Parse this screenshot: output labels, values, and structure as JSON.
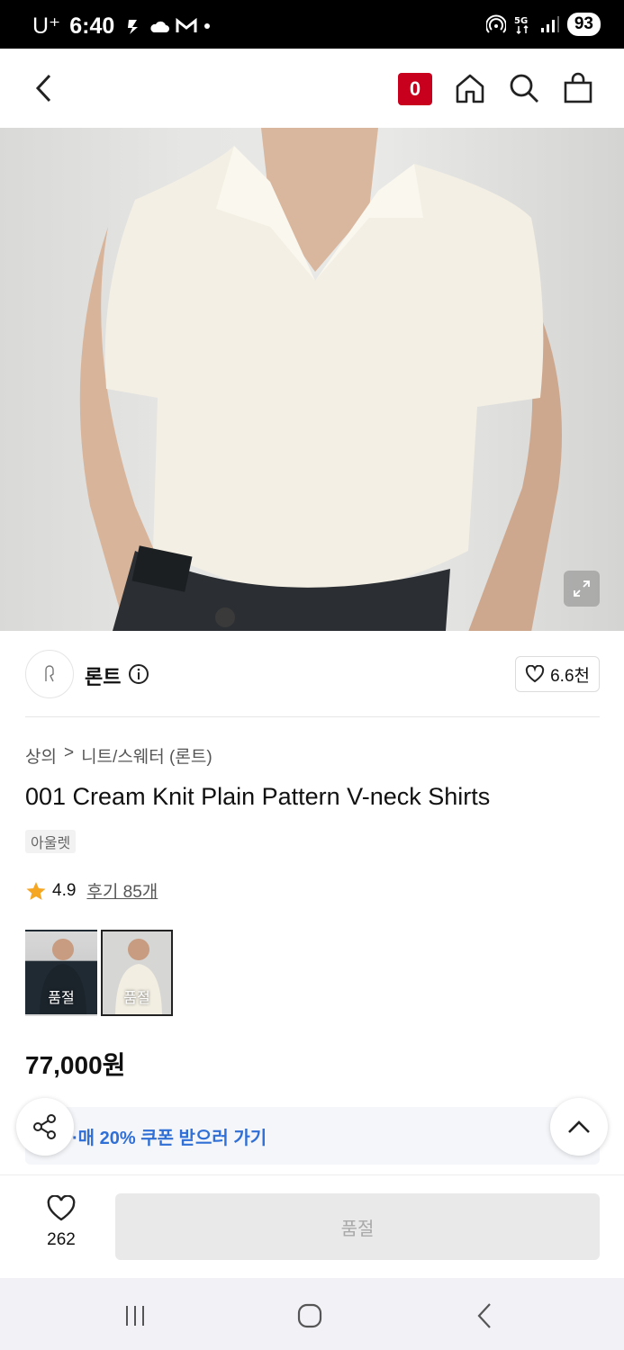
{
  "status_bar": {
    "carrier": "U⁺",
    "time": "6:40",
    "battery": "93",
    "icons": [
      "runner-icon",
      "cloud-icon",
      "gmail-icon",
      "hotspot-icon",
      "5g-icon",
      "signal-icon"
    ]
  },
  "header": {
    "cart_count": "0"
  },
  "brand": {
    "name": "론트",
    "likes": "6.6천"
  },
  "breadcrumb": {
    "category": "상의",
    "separator": ">",
    "subcategory": "니트/스웨터 (론트)"
  },
  "product": {
    "title": "001 Cream Knit Plain Pattern V-neck Shirts",
    "tag": "아울렛",
    "rating": "4.9",
    "review_link": "후기 85개",
    "price": "77,000원"
  },
  "swatches": [
    {
      "label": "품절",
      "color": "#1f2a33"
    },
    {
      "label": "품절",
      "color": "#f2eee2"
    }
  ],
  "coupon": {
    "text": "·매 20% 쿠폰 받으러 가기"
  },
  "bottom": {
    "wish_count": "262",
    "buy_label": "품절"
  },
  "colors": {
    "accent_red": "#c8001e",
    "coupon_blue": "#2f6fd6",
    "star": "#f5a623"
  }
}
